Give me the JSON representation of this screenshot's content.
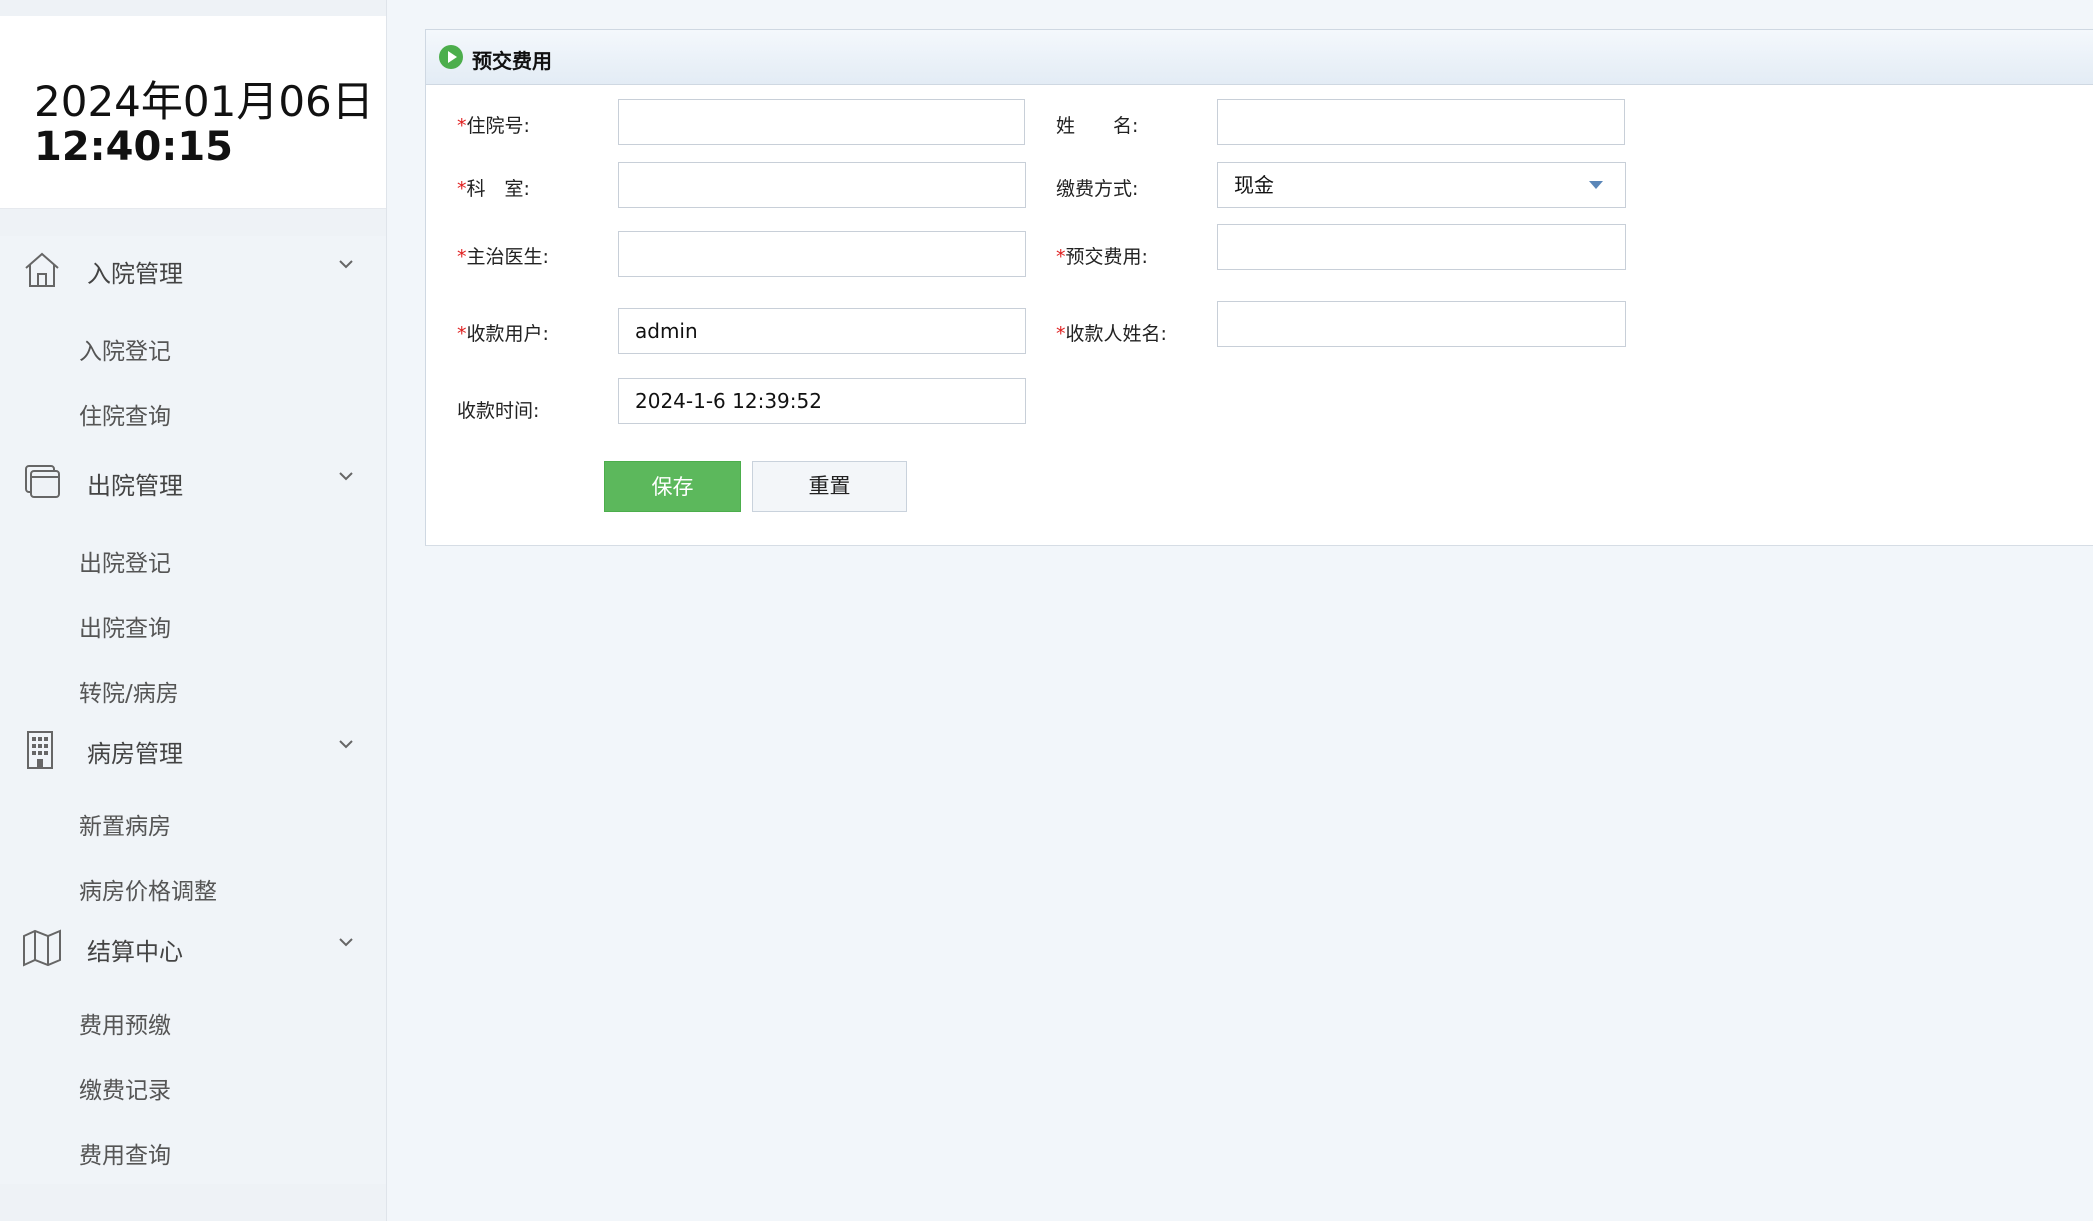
{
  "clock": {
    "date": "2024年01月06日",
    "time": "12:40:15"
  },
  "menu": {
    "groups": [
      {
        "label": "入院管理",
        "icon": "home-icon",
        "items": [
          "入院登记",
          "住院查询"
        ]
      },
      {
        "label": "出院管理",
        "icon": "window-stack-icon",
        "items": [
          "出院登记",
          "出院查询",
          "转院/病房"
        ]
      },
      {
        "label": "病房管理",
        "icon": "building-icon",
        "items": [
          "新置病房",
          "病房价格调整"
        ]
      },
      {
        "label": "结算中心",
        "icon": "map-icon",
        "items": [
          "费用预缴",
          "缴费记录",
          "费用查询"
        ]
      }
    ]
  },
  "panel": {
    "title": "预交费用",
    "icon": "play-circle-icon"
  },
  "form": {
    "required_mark": "*",
    "admission_no": {
      "label": "住院号:",
      "value": ""
    },
    "name": {
      "label": "姓　　名:",
      "value": ""
    },
    "department": {
      "label": "科　室:",
      "value": ""
    },
    "payment_method": {
      "label": "缴费方式:",
      "value": "现金"
    },
    "doctor": {
      "label": "主治医生:",
      "value": ""
    },
    "prepay_amount": {
      "label": "预交费用:",
      "value": ""
    },
    "cashier_user": {
      "label": "收款用户:",
      "value": "admin"
    },
    "cashier_name": {
      "label": "收款人姓名:",
      "value": ""
    },
    "payment_time": {
      "label": "收款时间:",
      "value": "2024-1-6 12:39:52"
    }
  },
  "buttons": {
    "save": "保存",
    "reset": "重置"
  },
  "colors": {
    "save": "#5cb85c",
    "progress": "#1a8fe6",
    "required": "#e02020"
  }
}
